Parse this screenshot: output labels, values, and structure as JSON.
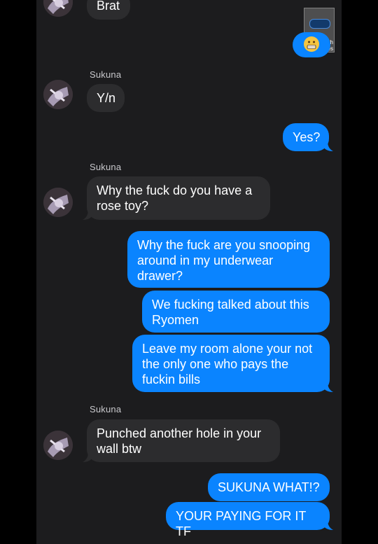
{
  "conversation": {
    "contact_name": "Sukuna",
    "messages": [
      {
        "id": "m1",
        "from": "incoming",
        "text": "Brat"
      },
      {
        "id": "m2",
        "from": "outgoing",
        "text": "😬"
      },
      {
        "id": "m3",
        "from": "incoming",
        "sender": "Sukuna",
        "text": "Y/n"
      },
      {
        "id": "m4",
        "from": "outgoing",
        "text": "Yes?"
      },
      {
        "id": "m5",
        "from": "incoming",
        "sender": "Sukuna",
        "text": "Why the fuck do you have a rose toy?"
      },
      {
        "id": "m6",
        "from": "outgoing",
        "text": "Why the fuck are you snooping around in my underwear drawer?"
      },
      {
        "id": "m7",
        "from": "outgoing",
        "text": "We fucking talked about this Ryomen"
      },
      {
        "id": "m8",
        "from": "outgoing",
        "text": "Leave my room alone your not the only one who pays the fuckin bills"
      },
      {
        "id": "m9",
        "from": "incoming",
        "sender": "Sukuna",
        "text": "Punched another hole in your wall btw"
      },
      {
        "id": "m10",
        "from": "outgoing",
        "text": "SUKUNA WHAT!?"
      },
      {
        "id": "m11",
        "from": "outgoing",
        "text": "YOUR PAYING FOR IT TF"
      }
    ]
  },
  "watermark": {
    "text": "e with ChatTales"
  },
  "colors": {
    "incoming_bubble": "#2c2c2e",
    "outgoing_bubble": "#0a84ff",
    "background": "#1c1c1e"
  }
}
